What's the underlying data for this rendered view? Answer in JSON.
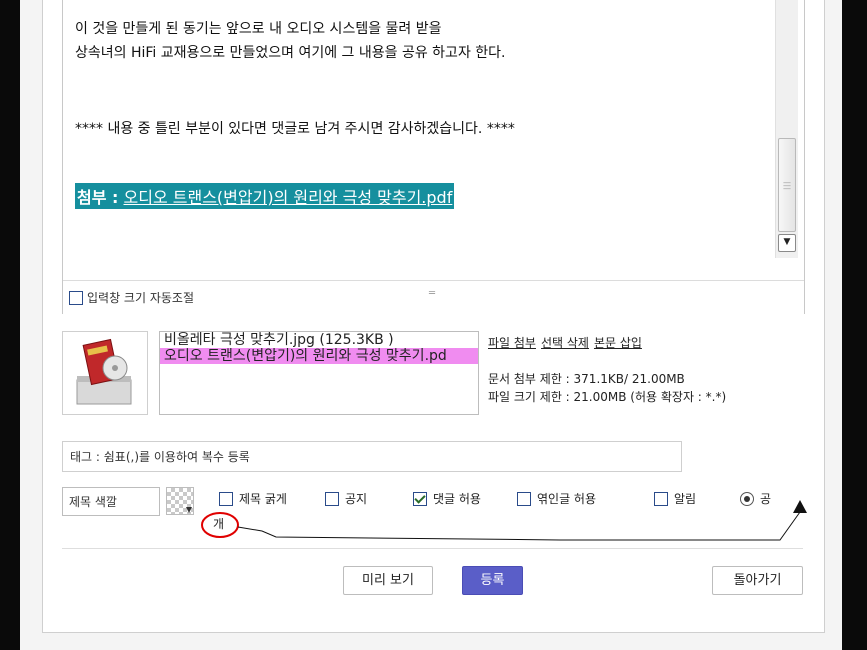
{
  "editor": {
    "lines": [
      "이 것을 만들게 된 동기는 앞으로 내 오디오 시스템을 물려 받을",
      "상속녀의 HiFi 교재용으로 만들었으며 여기에 그 내용을 공유 하고자 한다.",
      "**** 내용 중 틀린 부분이 있다면 댓글로 남겨 주시면 감사하겠습니다. ****"
    ],
    "attachment_label": "첨부 :",
    "attachment_link": "오디오 트랜스(변압기)의 원리와 극성 맞추기.pdf",
    "autosize_label": "입력창 크기 자동조절"
  },
  "files": {
    "items": [
      {
        "text": "비올레타 극성 맞추기.jpg (125.3KB )",
        "selected": false
      },
      {
        "text": "오디오 트랜스(변압기)의 원리와 극성 맞추기.pd",
        "selected": true
      }
    ],
    "actions": [
      "파일 첨부",
      "선택 삭제",
      "본문 삽입"
    ],
    "doc_limit": "문서 첨부 제한 : 371.1KB/ 21.00MB",
    "size_limit": "파일 크기 제한 : 21.00MB (허용 확장자 : *.*)"
  },
  "tag": {
    "placeholder": "태그 : 쉼표(,)를 이용하여 복수 등록"
  },
  "options": {
    "title_color_label": "제목 색깔",
    "bold_title": "제목 굵게",
    "notice": "공지",
    "allow_comments": "댓글 허용",
    "allow_trackback": "엮인글 허용",
    "notify": "알림",
    "public_label": "공",
    "public_wrap": "개"
  },
  "buttons": {
    "preview": "미리 보기",
    "submit": "등록",
    "back": "돌아가기"
  },
  "colors": {
    "attachment_bg": "#158f9e",
    "selected_file": "#f08cf0",
    "submit_button": "#5a5ec8",
    "annotation": "#e00000"
  }
}
